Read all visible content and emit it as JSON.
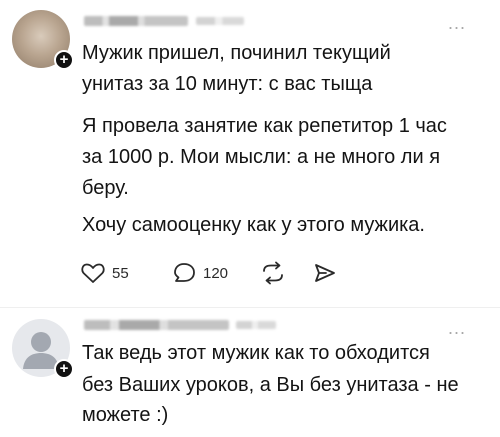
{
  "posts": [
    {
      "more_label": "...",
      "paragraphs": [
        {
          "lines": [
            "Мужик пришел, починил текущий",
            "унитаз за 10 минут: с вас тыща"
          ]
        },
        {
          "lines": [
            "Я провела занятие как репетитор 1 час",
            "за 1000 р. Мои мысли: а не много ли я",
            "беру."
          ]
        },
        {
          "lines": [
            "Хочу самооценку как у этого мужика."
          ]
        }
      ],
      "actions": {
        "like_count": "55",
        "comment_count": "120",
        "like_icon": "heart-icon",
        "comment_icon": "comment-icon",
        "repost_icon": "repost-icon",
        "share_icon": "share-icon"
      }
    },
    {
      "more_label": "...",
      "paragraphs": [
        {
          "lines": [
            "Так ведь этот мужик как то обходится",
            "без Ваших уроков, а Вы без унитаза - не",
            "можете :)"
          ]
        }
      ]
    }
  ],
  "badge_label": "+"
}
